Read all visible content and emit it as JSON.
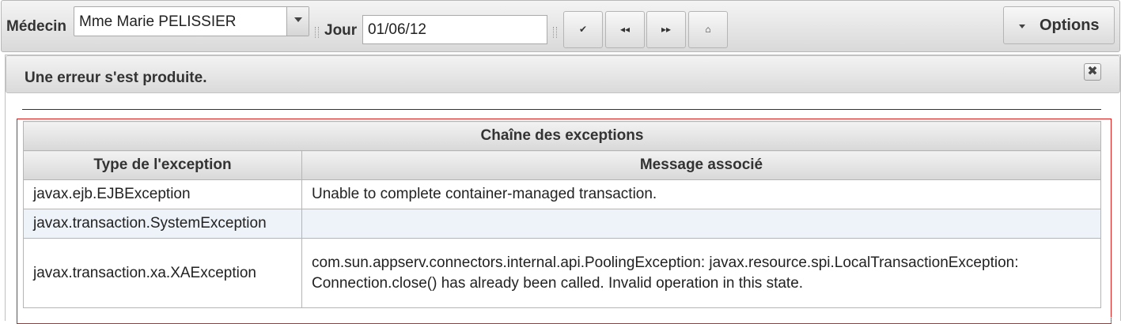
{
  "toolbar": {
    "medecin_label": "Médecin",
    "medecin_value": "Mme Marie PELISSIER",
    "jour_label": "Jour",
    "jour_value": "01/06/12",
    "btn_validate": "✔",
    "btn_prev": "◂◂",
    "btn_next": "▸▸",
    "btn_home": "⌂",
    "options_label": "Options"
  },
  "error_panel": {
    "title": "Une erreur s'est produite.",
    "close_glyph": "✖"
  },
  "exceptions_table": {
    "caption": "Chaîne des exceptions",
    "col_type": "Type de l'exception",
    "col_message": "Message associé",
    "rows": [
      {
        "type": "javax.ejb.EJBException",
        "message": "Unable to complete container-managed transaction."
      },
      {
        "type": "javax.transaction.SystemException",
        "message": ""
      },
      {
        "type": "javax.transaction.xa.XAException",
        "message": "com.sun.appserv.connectors.internal.api.PoolingException: javax.resource.spi.LocalTransactionException: Connection.close() has already been called. Invalid operation in this state."
      }
    ]
  }
}
